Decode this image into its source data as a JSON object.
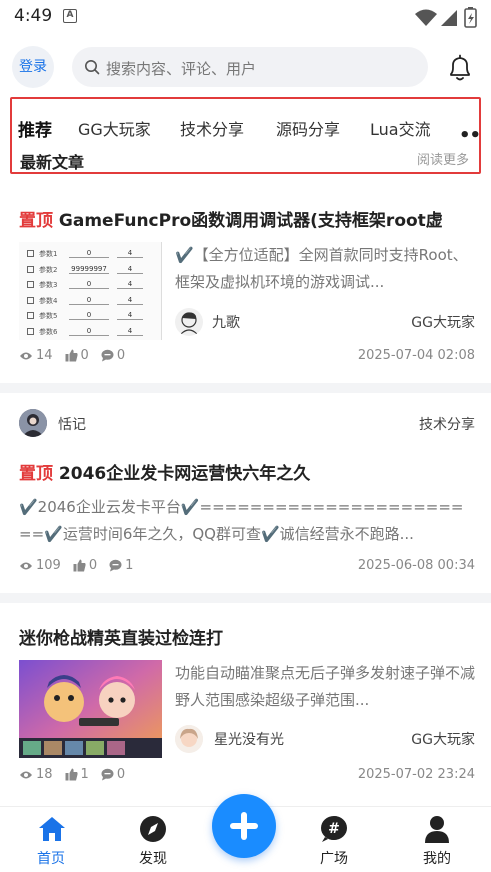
{
  "status_bar": {
    "time": "4:49",
    "notification_icon": "A"
  },
  "header": {
    "login_label": "登录",
    "search_placeholder": "搜索内容、评论、用户"
  },
  "tabs": [
    {
      "label": "推荐",
      "active": true
    },
    {
      "label": "GG大玩家",
      "active": false
    },
    {
      "label": "技术分享",
      "active": false
    },
    {
      "label": "源码分享",
      "active": false
    },
    {
      "label": "Lua交流",
      "active": false
    }
  ],
  "tabs_more": "•••",
  "section": {
    "title": "最新文章",
    "more": "阅读更多"
  },
  "posts": [
    {
      "pinned_label": "置顶",
      "title": "GameFuncPro函数调用调试器(支持框架root虚",
      "excerpt": "✔️【全方位适配】全网首款同时支持Root、框架及虚拟机环境的游戏调试...",
      "author": "九歌",
      "category": "GG大玩家",
      "views": "14",
      "likes": "0",
      "comments": "0",
      "date": "2025-07-04 02:08",
      "thumb_rows": [
        {
          "label": "参数1",
          "value": "0",
          "value2": "4"
        },
        {
          "label": "参数2",
          "value": "99999997",
          "value2": "4"
        },
        {
          "label": "参数3",
          "value": "0",
          "value2": "4"
        },
        {
          "label": "参数4",
          "value": "0",
          "value2": "4"
        },
        {
          "label": "参数5",
          "value": "0",
          "value2": "4"
        },
        {
          "label": "参数6",
          "value": "0",
          "value2": "4"
        }
      ]
    },
    {
      "author": "恬记",
      "category": "技术分享",
      "pinned_label": "置顶",
      "title": "2046企业发卡网运营快六年之久",
      "excerpt": "✔️2046企业云发卡平台✔️=======================✔️运营时间6年之久，QQ群可查✔️诚信经营永不跑路...",
      "views": "109",
      "likes": "0",
      "comments": "1",
      "date": "2025-06-08 00:34"
    },
    {
      "title": "迷你枪战精英直装过检连打",
      "excerpt": "功能自动瞄准聚点无后子弹多发射速子弹不减野人范围感染超级子弹范围...",
      "author": "星光没有光",
      "category": "GG大玩家",
      "views": "18",
      "likes": "1",
      "comments": "0",
      "date": "2025-07-02 23:24"
    }
  ],
  "bottom_nav": [
    {
      "label": "首页",
      "icon": "home-icon",
      "active": true
    },
    {
      "label": "发现",
      "icon": "compass-icon",
      "active": false
    },
    {
      "label": "广场",
      "icon": "hashtag-icon",
      "active": false
    },
    {
      "label": "我的",
      "icon": "user-icon",
      "active": false
    }
  ],
  "colors": {
    "accent": "#1a73e8",
    "pinned": "#e23b3b",
    "fab": "#1a8cff"
  }
}
